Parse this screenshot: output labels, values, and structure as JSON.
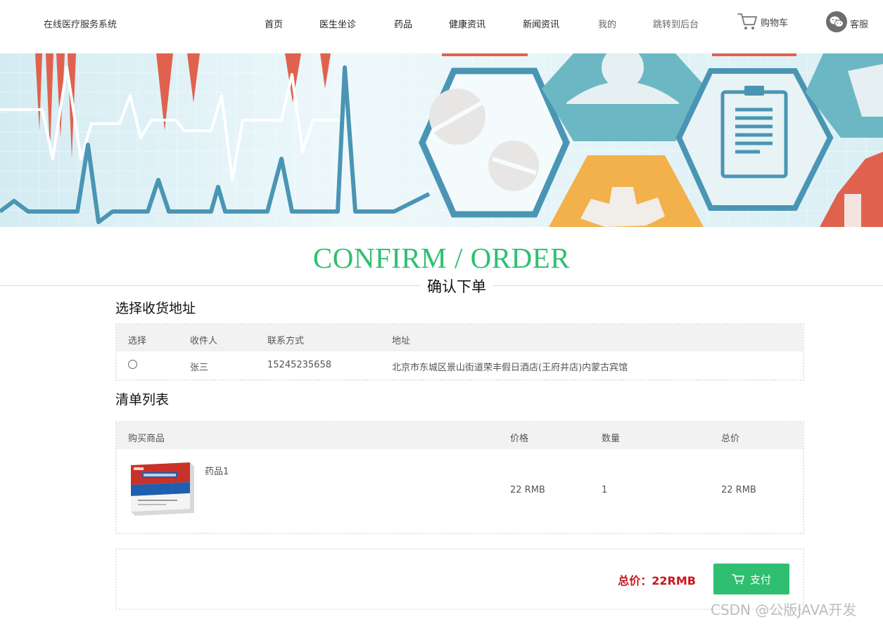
{
  "header": {
    "site_title": "在线医疗服务系统",
    "nav": [
      "首页",
      "医生坐诊",
      "药品",
      "健康资讯",
      "新闻资讯",
      "我的",
      "跳转到后台"
    ],
    "cart_label": "购物车",
    "service_label": "客服"
  },
  "section": {
    "title_en": "CONFIRM / ORDER",
    "title_cn": "确认下单"
  },
  "address": {
    "heading": "选择收货地址",
    "columns": [
      "选择",
      "收件人",
      "联系方式",
      "地址"
    ],
    "rows": [
      {
        "name": "张三",
        "phone": "15245235658",
        "address": "北京市东城区景山街道荣丰假日酒店(王府井店)内蒙古宾馆"
      }
    ]
  },
  "cart": {
    "heading": "清单列表",
    "columns": [
      "购买商品",
      "价格",
      "数量",
      "总价"
    ],
    "items": [
      {
        "name": "药品1",
        "price": "22 RMB",
        "qty": "1",
        "total": "22 RMB"
      }
    ]
  },
  "summary": {
    "total_label": "总价：22RMB",
    "pay_label": "支付"
  },
  "watermark": "CSDN @公版JAVA开发",
  "colors": {
    "accent_green": "#2fbf71",
    "total_red": "#c9151e",
    "banner_blue": "#4a95b4",
    "banner_red": "#e0624e",
    "banner_orange": "#f2b14a"
  }
}
